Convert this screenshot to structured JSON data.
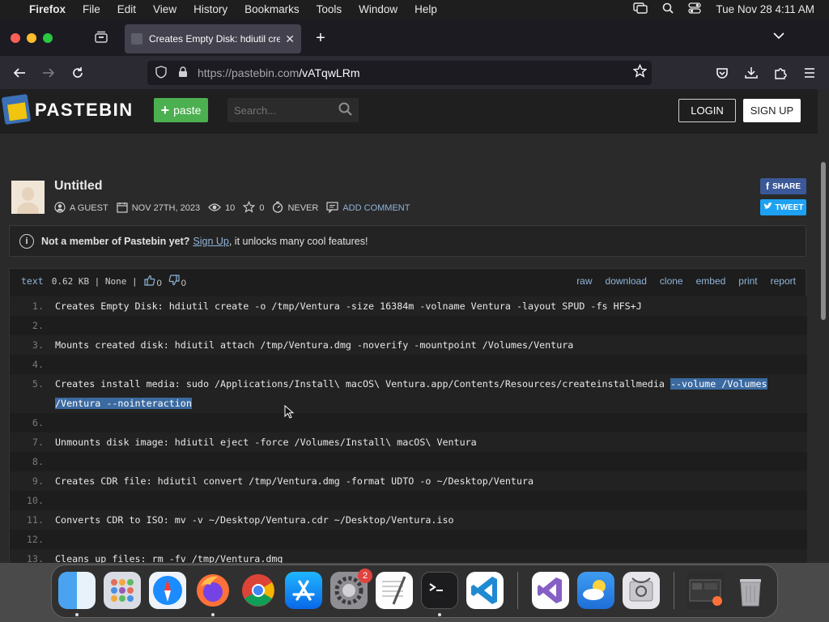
{
  "menubar": {
    "app": "Firefox",
    "menus": [
      "File",
      "Edit",
      "View",
      "History",
      "Bookmarks",
      "Tools",
      "Window",
      "Help"
    ],
    "datetime": "Tue Nov 28  4:11 AM"
  },
  "browser": {
    "tab_title": "Creates Empty Disk: hdiutil create",
    "url_host": "https://pastebin.com",
    "url_path": "/vATqwLRm"
  },
  "pastebin": {
    "brand": "PASTEBIN",
    "paste_button": "paste",
    "search_placeholder": "Search...",
    "login": "LOGIN",
    "signup": "SIGN UP",
    "title": "Untitled",
    "author": "A GUEST",
    "date": "NOV 27TH, 2023",
    "views": "10",
    "stars": "0",
    "expiry": "NEVER",
    "add_comment": "ADD COMMENT",
    "share": "SHARE",
    "tweet": "TWEET",
    "notice_bold": "Not a member of Pastebin yet?",
    "notice_link": "Sign Up",
    "notice_rest": ", it unlocks many cool features!",
    "syntax": "text",
    "size_info": "0.62 KB | None |",
    "likes": "0",
    "dislikes": "0",
    "actions": [
      "raw",
      "download",
      "clone",
      "embed",
      "print",
      "report"
    ]
  },
  "code_lines": [
    {
      "n": "1.",
      "text": "Creates Empty Disk: hdiutil create -o /tmp/Ventura -size 16384m -volname Ventura -layout SPUD -fs HFS+J"
    },
    {
      "n": "2.",
      "text": ""
    },
    {
      "n": "3.",
      "text": "Mounts created disk: hdiutil attach /tmp/Ventura.dmg -noverify -mountpoint /Volumes/Ventura"
    },
    {
      "n": "4.",
      "text": ""
    },
    {
      "n": "5.",
      "text": "Creates install media: sudo /Applications/Install\\ macOS\\ Ventura.app/Contents/Resources/createinstallmedia ",
      "hl": "--volume /Volumes"
    },
    {
      "n": "",
      "text": "",
      "hl": "/Ventura --nointeraction"
    },
    {
      "n": "6.",
      "text": ""
    },
    {
      "n": "7.",
      "text": "Unmounts disk image: hdiutil eject -force /Volumes/Install\\ macOS\\ Ventura"
    },
    {
      "n": "8.",
      "text": ""
    },
    {
      "n": "9.",
      "text": "Creates CDR file: hdiutil convert /tmp/Ventura.dmg -format UDTO -o ~/Desktop/Ventura"
    },
    {
      "n": "10.",
      "text": ""
    },
    {
      "n": "11.",
      "text": "Converts CDR to ISO: mv -v ~/Desktop/Ventura.cdr ~/Desktop/Ventura.iso"
    },
    {
      "n": "12.",
      "text": ""
    },
    {
      "n": "13.",
      "text": "Cleans up files: rm -fv /tmp/Ventura.dmg"
    }
  ],
  "dock": {
    "settings_badge": "2",
    "apps": [
      "Finder",
      "Launchpad",
      "Safari",
      "Firefox",
      "Chrome",
      "App Store",
      "System Settings",
      "TextEdit",
      "Terminal",
      "VS Code",
      "Visual Studio",
      "Weather",
      "Disk Utility",
      "Downloads",
      "Trash"
    ]
  }
}
